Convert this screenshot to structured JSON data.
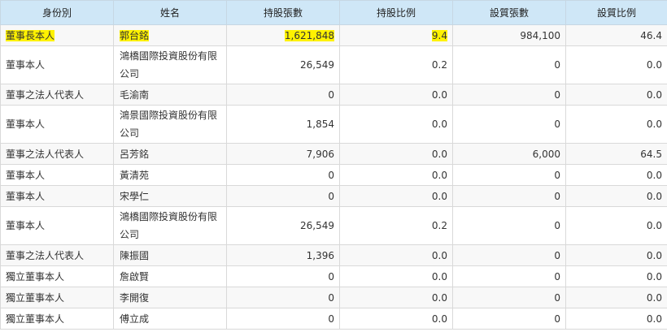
{
  "header": {
    "role": "身份別",
    "name": "姓名",
    "shares": "持股張數",
    "share_ratio": "持股比例",
    "pledged": "設質張數",
    "pledge_ratio": "設質比例"
  },
  "rows": [
    {
      "role": "董事長本人",
      "name": "郭台銘",
      "shares": "1,621,848",
      "share_ratio": "9.4",
      "pledged": "984,100",
      "pledge_ratio": "46.4",
      "highlight": true
    },
    {
      "role": "董事本人",
      "name": "鴻橋國際投資股份有限公司",
      "shares": "26,549",
      "share_ratio": "0.2",
      "pledged": "0",
      "pledge_ratio": "0.0",
      "tall": true
    },
    {
      "role": "董事之法人代表人",
      "name": "毛渝南",
      "shares": "0",
      "share_ratio": "0.0",
      "pledged": "0",
      "pledge_ratio": "0.0"
    },
    {
      "role": "董事本人",
      "name": "鴻景國際投資股份有限公司",
      "shares": "1,854",
      "share_ratio": "0.0",
      "pledged": "0",
      "pledge_ratio": "0.0",
      "tall": true
    },
    {
      "role": "董事之法人代表人",
      "name": "呂芳銘",
      "shares": "7,906",
      "share_ratio": "0.0",
      "pledged": "6,000",
      "pledge_ratio": "64.5"
    },
    {
      "role": "董事本人",
      "name": "黃清苑",
      "shares": "0",
      "share_ratio": "0.0",
      "pledged": "0",
      "pledge_ratio": "0.0"
    },
    {
      "role": "董事本人",
      "name": "宋學仁",
      "shares": "0",
      "share_ratio": "0.0",
      "pledged": "0",
      "pledge_ratio": "0.0"
    },
    {
      "role": "董事本人",
      "name": "鴻橋國際投資股份有限公司",
      "shares": "26,549",
      "share_ratio": "0.2",
      "pledged": "0",
      "pledge_ratio": "0.0",
      "tall": true
    },
    {
      "role": "董事之法人代表人",
      "name": "陳振國",
      "shares": "1,396",
      "share_ratio": "0.0",
      "pledged": "0",
      "pledge_ratio": "0.0"
    },
    {
      "role": "獨立董事本人",
      "name": "詹啟賢",
      "shares": "0",
      "share_ratio": "0.0",
      "pledged": "0",
      "pledge_ratio": "0.0"
    },
    {
      "role": "獨立董事本人",
      "name": "李開復",
      "shares": "0",
      "share_ratio": "0.0",
      "pledged": "0",
      "pledge_ratio": "0.0"
    },
    {
      "role": "獨立董事本人",
      "name": "傅立成",
      "shares": "0",
      "share_ratio": "0.0",
      "pledged": "0",
      "pledge_ratio": "0.0"
    }
  ],
  "colors": {
    "header_bg": "#cfe7f7",
    "highlight": "#fff200",
    "row_alt": "#f8f8f8"
  }
}
